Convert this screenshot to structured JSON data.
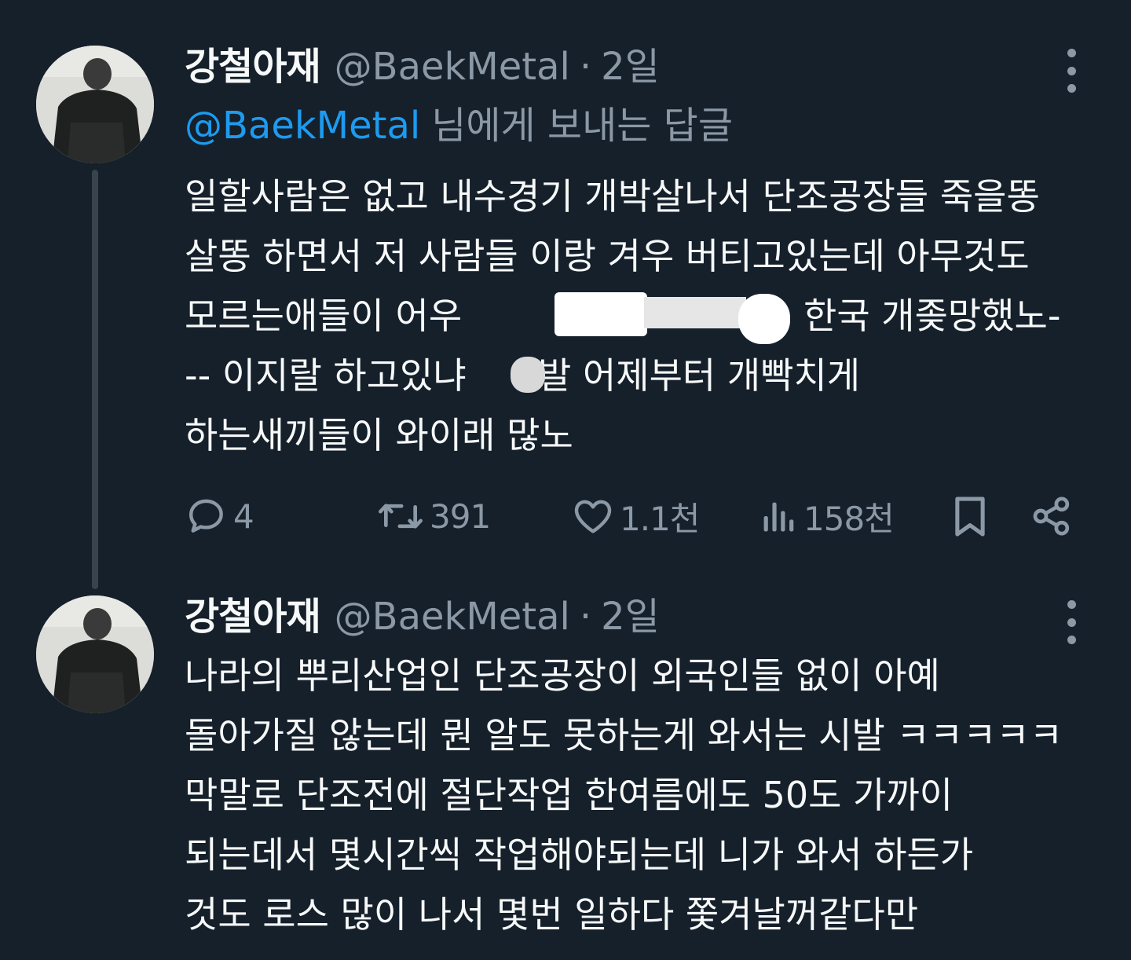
{
  "tweets": [
    {
      "display_name": "강철아재",
      "handle": "@BaekMetal",
      "separator": "·",
      "time": "2일",
      "avatar_icon": "avatar-photo",
      "reply_to": {
        "mention": "@BaekMetal",
        "suffix": "님에게 보내는 답글"
      },
      "text_lines": [
        "일할사람은 없고 내수경기 개박살나서 단조공장들 죽을똥",
        "살똥 하면서  저 사람들 이랑 겨우 버티고있는데 아무것도",
        "모르는애들이 어우",
        "한국 개좆망했노-",
        "-- 이지랄 하고있냐",
        "발 어제부터 개빡치게",
        "하는새끼들이 와이래 많노"
      ],
      "actions": {
        "reply_count": "4",
        "retweet_count": "391",
        "like_count": "1.1천",
        "view_count": "158천"
      }
    },
    {
      "display_name": "강철아재",
      "handle": "@BaekMetal",
      "separator": "·",
      "time": "2일",
      "avatar_icon": "avatar-photo",
      "text_lines": [
        "나라의 뿌리산업인 단조공장이 외국인들 없이 아예",
        "돌아가질 않는데 뭔 알도 못하는게 와서는 시발 ㅋㅋㅋㅋㅋ",
        "막말로 단조전에 절단작업 한여름에도 50도 가까이",
        "되는데서 몇시간씩 작업해야되는데 니가 와서 하든가",
        "것도 로스 많이 나서 몇번 일하다 쫓겨날꺼같다만"
      ]
    }
  ],
  "colors": {
    "background": "#15202b",
    "text": "#f7f9f9",
    "secondary": "#8b98a5",
    "link": "#1d9bf0",
    "thread_line": "#38444d"
  },
  "icons": [
    "more-icon",
    "reply-icon",
    "retweet-icon",
    "like-icon",
    "views-icon",
    "bookmark-icon",
    "share-icon"
  ]
}
